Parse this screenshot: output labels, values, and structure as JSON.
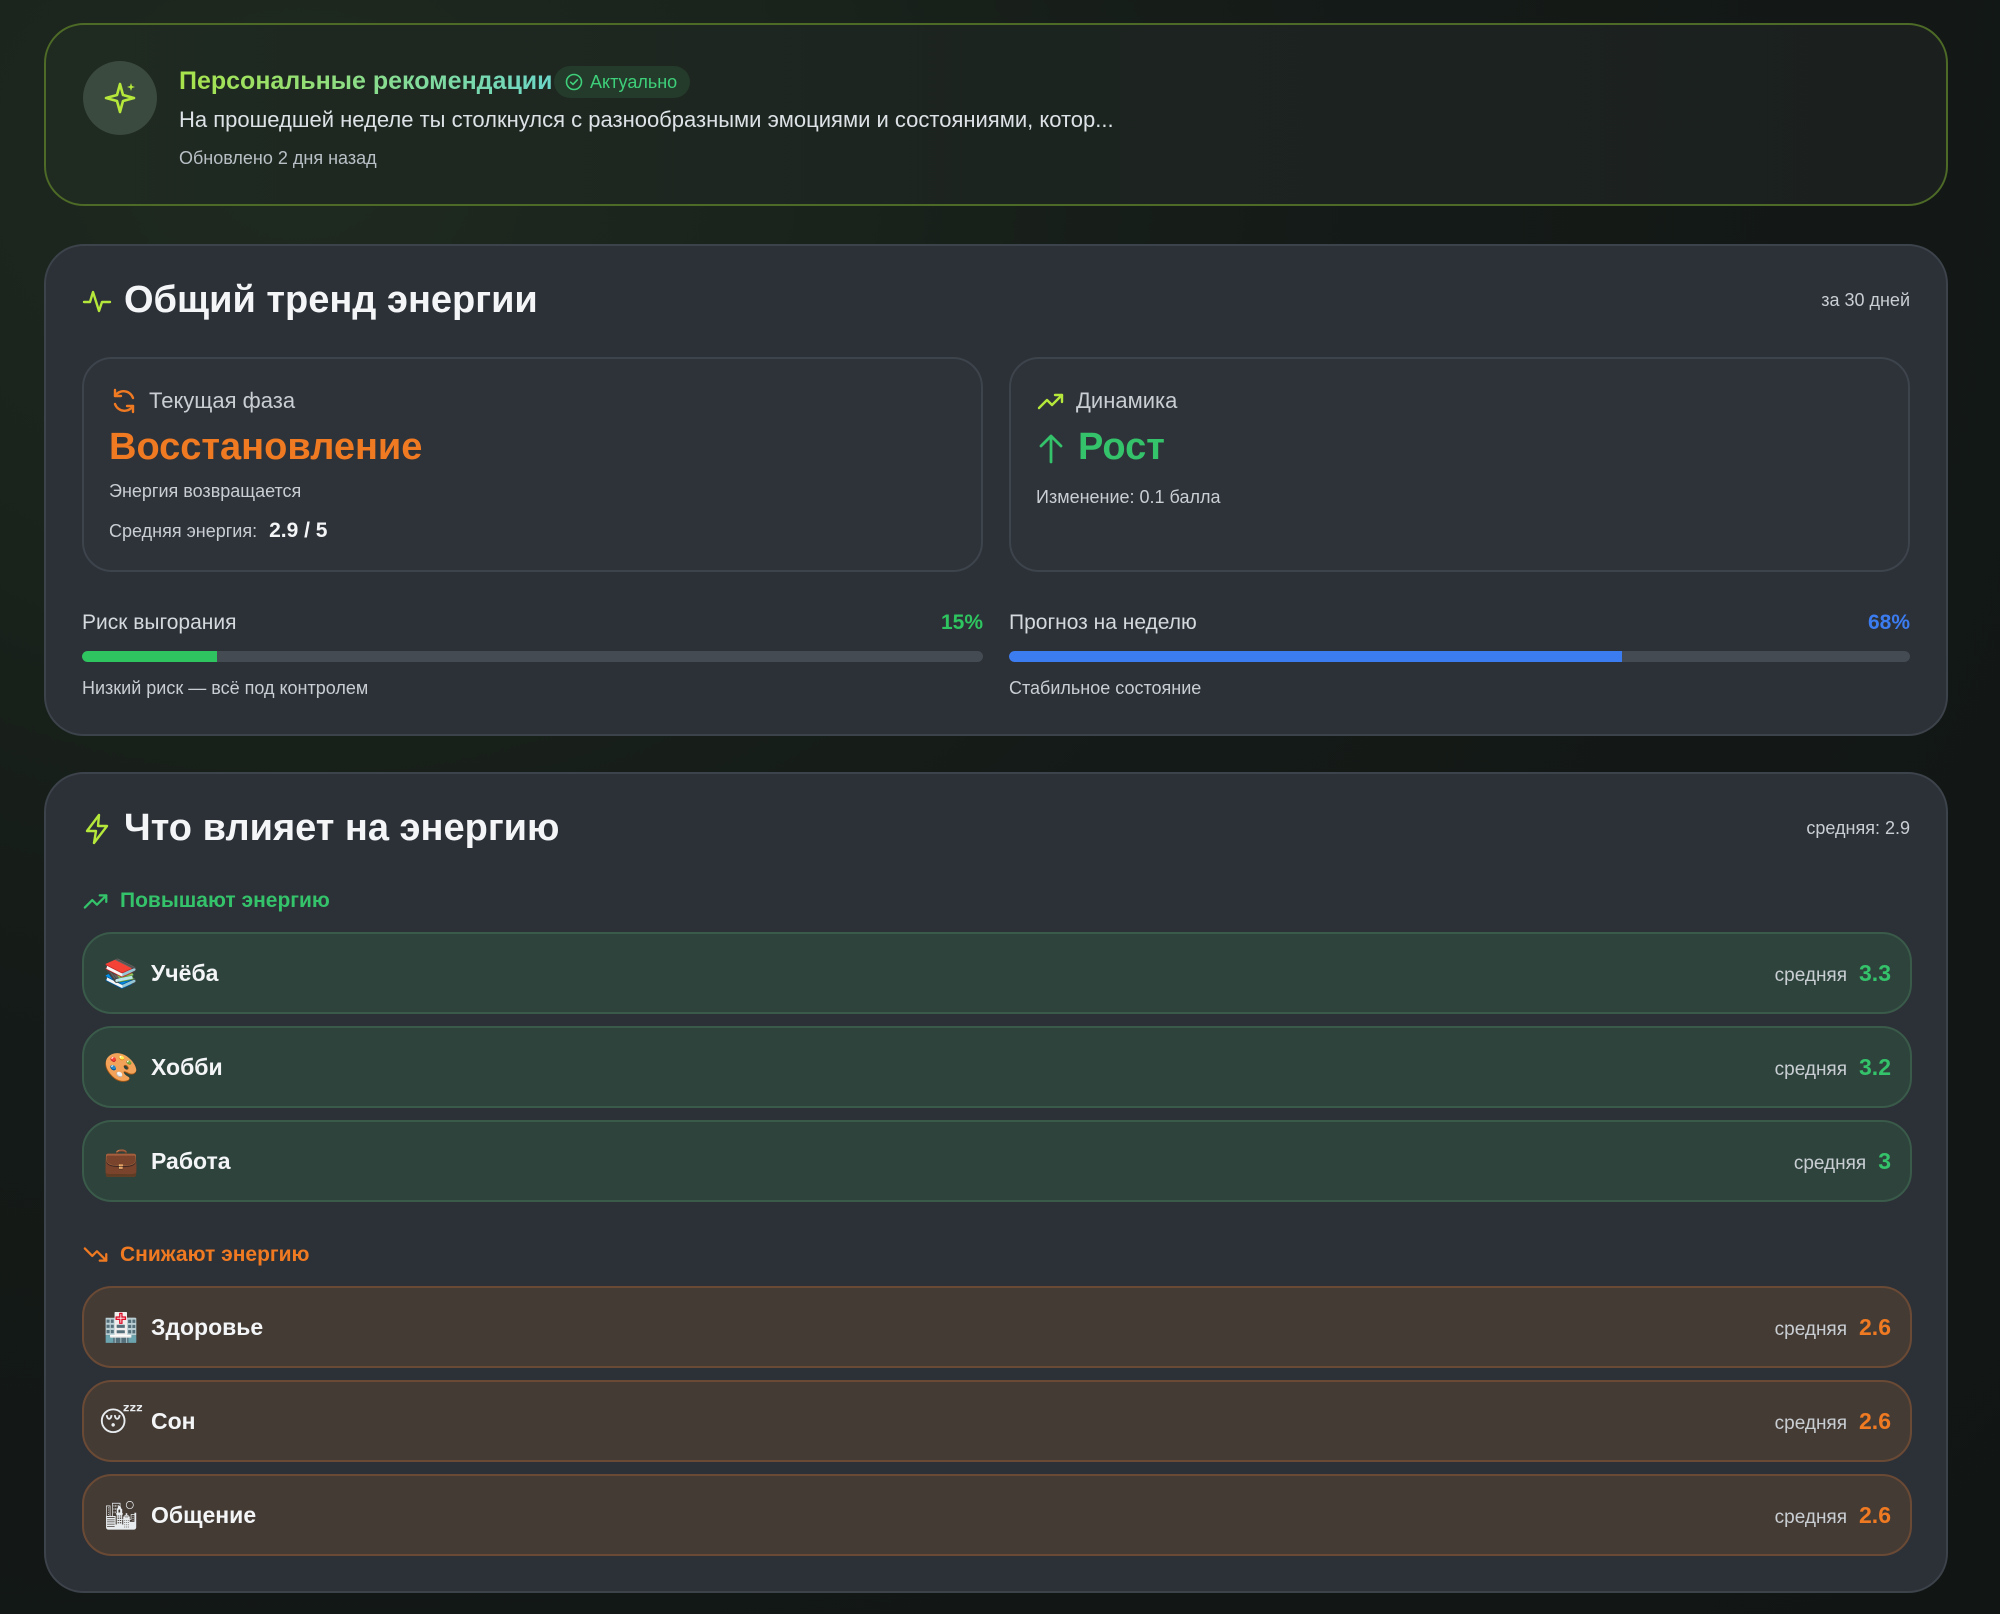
{
  "recommendation": {
    "title": "Персональные рекомендации",
    "badge": "Актуально",
    "text": "На прошедшей неделе ты столкнулся с разнообразными эмоциями и состояниями, котор...",
    "updated": "Обновлено 2 дня назад"
  },
  "trend": {
    "title": "Общий тренд энергии",
    "period": "за 30 дней",
    "phase": {
      "label": "Текущая фаза",
      "value": "Восстановление",
      "description": "Энергия возвращается",
      "avg_label": "Средняя энергия:",
      "avg_value": "2.9 / 5"
    },
    "dynamics": {
      "label": "Динамика",
      "value": "Рост",
      "change": "Изменение: 0.1 балла"
    },
    "burnout": {
      "label": "Риск выгорания",
      "percent_text": "15%",
      "level": 0.15,
      "note": "Низкий риск — всё под контролем",
      "color": "#2ec45f"
    },
    "forecast": {
      "label": "Прогноз на неделю",
      "percent_text": "68%",
      "level": 0.68,
      "note": "Стабильное состояние",
      "color": "#3b7cf0"
    }
  },
  "factors": {
    "title": "Что влияет на энергию",
    "average": "средняя: 2.9",
    "increase": {
      "label": "Повышают энергию",
      "color": "#34c26a",
      "items": [
        {
          "emoji": "📚",
          "name": "Учёба",
          "avg_label": "средняя",
          "value": "3.3"
        },
        {
          "emoji": "🎨",
          "name": "Хобби",
          "avg_label": "средняя",
          "value": "3.2"
        },
        {
          "emoji": "💼",
          "name": "Работа",
          "avg_label": "средняя",
          "value": "3"
        }
      ]
    },
    "decrease": {
      "label": "Снижают энергию",
      "color": "#f07a22",
      "items": [
        {
          "emoji": "🏥",
          "name": "Здоровье",
          "avg_label": "средняя",
          "value": "2.6"
        },
        {
          "emoji": "😴",
          "name": "Сон",
          "avg_label": "средняя",
          "value": "2.6"
        },
        {
          "emoji": "🏙",
          "name": "Общение",
          "avg_label": "средняя",
          "value": "2.6"
        }
      ]
    }
  },
  "icons": {
    "recommendation": "sparkles-icon",
    "trend": "activity-icon",
    "phase": "refresh-icon",
    "dynamics": "trending-up-icon",
    "dynamics_value": "arrow-up-icon",
    "factors": "lightning-icon",
    "increase": "trending-up-icon",
    "decrease": "trending-down-icon",
    "badge": "check-circle-icon"
  }
}
